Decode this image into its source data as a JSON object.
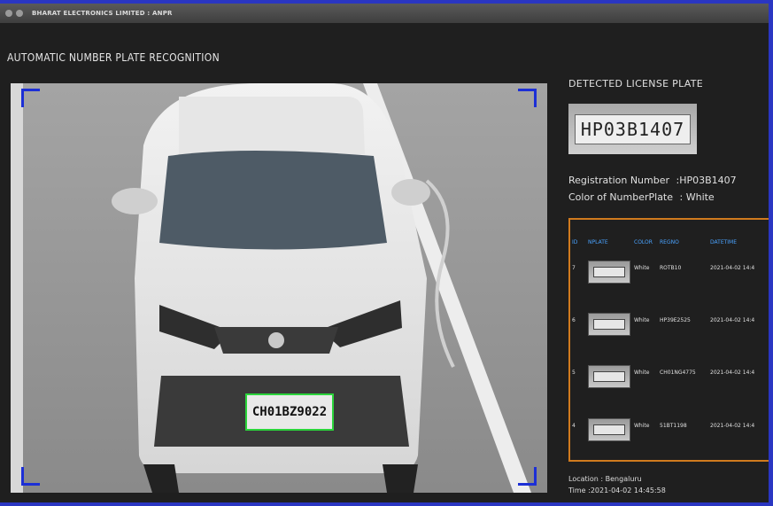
{
  "window": {
    "title": "BHARAT ELECTRONICS LIMITED : ANPR"
  },
  "app": {
    "heading": "AUTOMATIC NUMBER PLATE RECOGNITION"
  },
  "camera": {
    "captured_plate": "CH01BZ9022"
  },
  "detected": {
    "heading": "DETECTED LICENSE PLATE",
    "plate_text": "HP03B1407",
    "registration_label": "Registration Number",
    "registration_value": ":HP03B1407",
    "color_label": "Color of NumberPlate",
    "color_value": ": White"
  },
  "history": {
    "columns": [
      "ID",
      "NPLATE",
      "COLOR",
      "REGNO",
      "DATETIME"
    ],
    "rows": [
      {
        "id": "7",
        "color": "White",
        "regno": "ROTB10",
        "datetime": "2021-04-02 14:4"
      },
      {
        "id": "6",
        "color": "White",
        "regno": "HP39E2525",
        "datetime": "2021-04-02 14:4"
      },
      {
        "id": "5",
        "color": "White",
        "regno": "CH01NG4775",
        "datetime": "2021-04-02 14:4"
      },
      {
        "id": "4",
        "color": "White",
        "regno": "51BT1198",
        "datetime": "2021-04-02 14:4"
      }
    ]
  },
  "meta": {
    "location_label": "Location",
    "location_value": ": Bengaluru",
    "time_label": "Time",
    "time_value": ":2021-04-02 14:45:58"
  },
  "colors": {
    "accent_border": "#d07a1e",
    "frame_corners": "#1c2fd6",
    "detection_box": "#2bd43b",
    "header_text": "#4aa3ff"
  }
}
